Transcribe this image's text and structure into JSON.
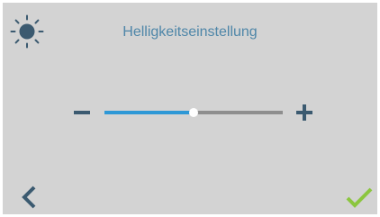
{
  "header": {
    "title": "Helligkeitseinstellung",
    "icon": "brightness-sun-icon"
  },
  "brightness": {
    "level_fraction": 0.5,
    "decrease_icon": "minus-icon",
    "increase_icon": "plus-icon"
  },
  "footer": {
    "back_icon": "chevron-left-icon",
    "confirm_icon": "checkmark-icon"
  },
  "colors": {
    "background": "#d3d3d3",
    "title_text": "#4e86a8",
    "icon_dark": "#3b5a70",
    "slider_fill": "#2e98d6",
    "slider_track": "#8e8e8e",
    "slider_thumb": "#ffffff",
    "confirm": "#8cc63f"
  }
}
